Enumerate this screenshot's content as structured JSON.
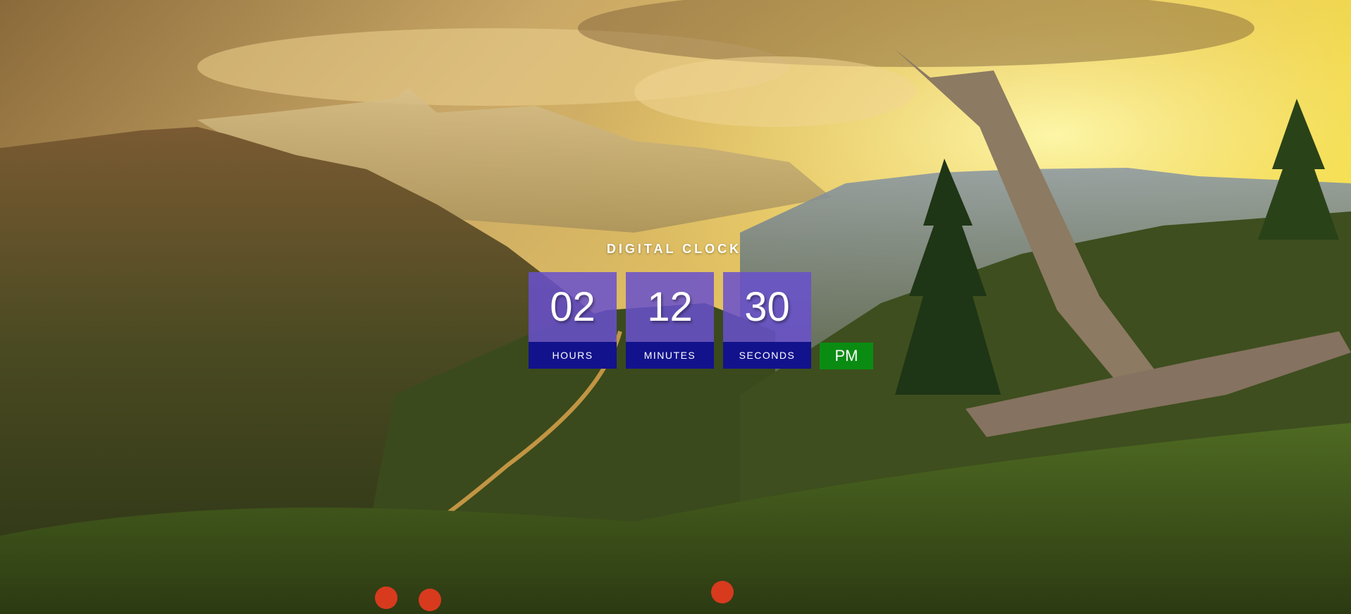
{
  "clock": {
    "title": "DIGITAL CLOCK",
    "hours": {
      "value": "02",
      "label": "HOURS"
    },
    "minutes": {
      "value": "12",
      "label": "MINUTES"
    },
    "seconds": {
      "value": "30",
      "label": "SECONDS"
    },
    "period": "PM"
  },
  "colors": {
    "digit_panel": "#6850ce",
    "label_panel": "#12128c",
    "period_badge": "#0a8c12"
  },
  "background": {
    "scene": "mountain-valley-sunset-photo"
  }
}
